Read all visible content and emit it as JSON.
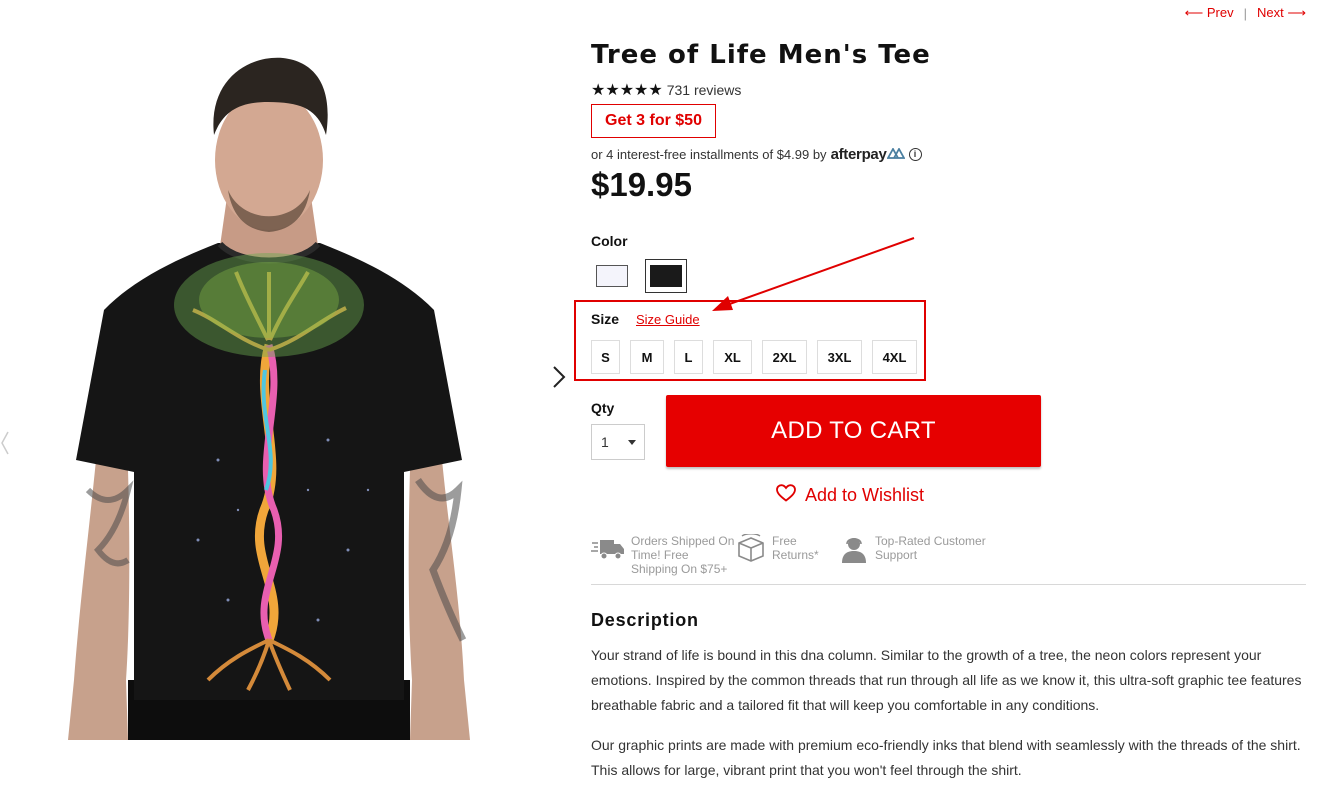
{
  "nav": {
    "prev": "⟵ Prev",
    "separator": "|",
    "next": "Next ⟶"
  },
  "product": {
    "title": "Tree of Life Men's Tee",
    "rating_stars": "★★★★★",
    "rating": 5,
    "reviews": "731 reviews",
    "promo": "Get 3 for $50",
    "installments_text": "or 4 interest-free installments of $4.99 by",
    "afterpay_brand": "afterpay",
    "price": "$19.95"
  },
  "color": {
    "label": "Color",
    "options": [
      "white",
      "black"
    ],
    "selected": "black"
  },
  "size": {
    "label": "Size",
    "guide": "Size Guide",
    "options": [
      "S",
      "M",
      "L",
      "XL",
      "2XL",
      "3XL",
      "4XL"
    ]
  },
  "qty": {
    "label": "Qty",
    "value": "1"
  },
  "cart": {
    "button": "ADD TO CART"
  },
  "wishlist": {
    "label": "Add to Wishlist"
  },
  "features": [
    {
      "icon": "shipping-truck-icon",
      "text": "Orders Shipped On Time! Free Shipping On $75+"
    },
    {
      "icon": "return-box-icon",
      "text": "Free Returns*"
    },
    {
      "icon": "customer-support-icon",
      "text": "Top-Rated Customer Support"
    }
  ],
  "description": {
    "title": "Description",
    "p1": "Your strand of life is bound in this dna column. Similar to the growth of a tree, the neon colors represent your emotions. Inspired by the common threads that run through all life as we know it, this ultra-soft graphic tee features breathable fabric and a tailored fit that will keep you comfortable in any conditions.",
    "p2": "Our graphic prints are made with premium eco-friendly inks that blend with seamlessly with the threads of the shirt. This allows for  large, vibrant print that you won't feel through the shirt."
  },
  "colors": {
    "accent": "#e00000",
    "button": "#e60000",
    "text": "#111111",
    "muted": "#9a9a9a"
  }
}
